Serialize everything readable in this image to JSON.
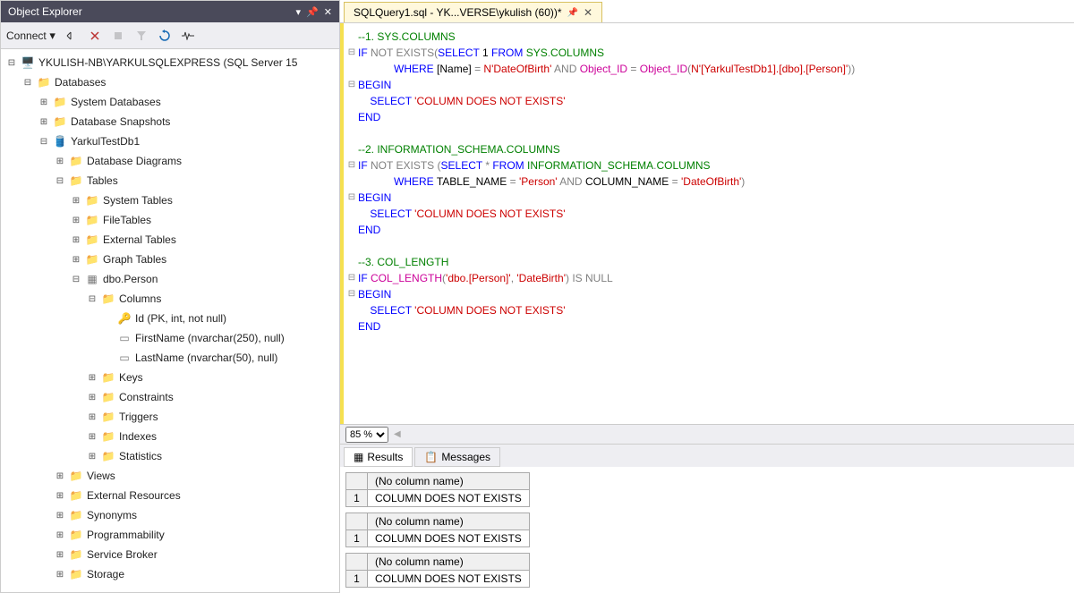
{
  "explorer": {
    "title": "Object Explorer",
    "connect_label": "Connect",
    "server": "YKULISH-NB\\YARKULSQLEXPRESS (SQL Server 15",
    "nodes": {
      "databases": "Databases",
      "system_databases": "System Databases",
      "database_snapshots": "Database Snapshots",
      "yarkultestdb1": "YarkulTestDb1",
      "database_diagrams": "Database Diagrams",
      "tables": "Tables",
      "system_tables": "System Tables",
      "filetables": "FileTables",
      "external_tables": "External Tables",
      "graph_tables": "Graph Tables",
      "dbo_person": "dbo.Person",
      "columns": "Columns",
      "col_id": "Id (PK, int, not null)",
      "col_firstname": "FirstName (nvarchar(250), null)",
      "col_lastname": "LastName (nvarchar(50), null)",
      "keys": "Keys",
      "constraints": "Constraints",
      "triggers": "Triggers",
      "indexes": "Indexes",
      "statistics": "Statistics",
      "views": "Views",
      "external_resources": "External Resources",
      "synonyms": "Synonyms",
      "programmability": "Programmability",
      "service_broker": "Service Broker",
      "storage": "Storage"
    }
  },
  "tab": {
    "title": "SQLQuery1.sql - YK...VERSE\\ykulish (60))*"
  },
  "zoom": {
    "value": "85 %"
  },
  "results": {
    "tab_results": "Results",
    "tab_messages": "Messages",
    "col_header": "(No column name)",
    "rows": [
      {
        "n": "1",
        "v": "COLUMN DOES NOT EXISTS"
      },
      {
        "n": "1",
        "v": "COLUMN DOES NOT EXISTS"
      },
      {
        "n": "1",
        "v": "COLUMN DOES NOT EXISTS"
      }
    ]
  },
  "code": {
    "c1": "--1. SYS.COLUMNS",
    "l2a": "IF",
    "l2b": "NOT",
    "l2c": "EXISTS",
    "l2d": "SELECT",
    "l2e": "1",
    "l2f": "FROM",
    "l2g": "SYS",
    "l2h": "COLUMNS",
    "l3a": "WHERE",
    "l3b": "[Name]",
    "l3c": "N'DateOfBirth'",
    "l3d": "AND",
    "l3e": "Object_ID",
    "l3f": "Object_ID",
    "l3g": "N'[YarkulTestDb1].[dbo].[Person]'",
    "begin": "BEGIN",
    "end": "END",
    "select": "SELECT",
    "msg": "'COLUMN DOES NOT EXISTS'",
    "c2": "--2. INFORMATION_SCHEMA.COLUMNS",
    "l9c": "*",
    "l9e": "INFORMATION_SCHEMA",
    "l9f": "COLUMNS",
    "l10b": "TABLE_NAME",
    "l10c": "'Person'",
    "l10e": "COLUMN_NAME",
    "l10f": "'DateOfBirth'",
    "c3": "--3. COL_LENGTH",
    "l16b": "COL_LENGTH",
    "l16c": "'dbo.[Person]'",
    "l16d": "'DateBirth'",
    "l16e": "IS",
    "l16f": "NULL"
  }
}
